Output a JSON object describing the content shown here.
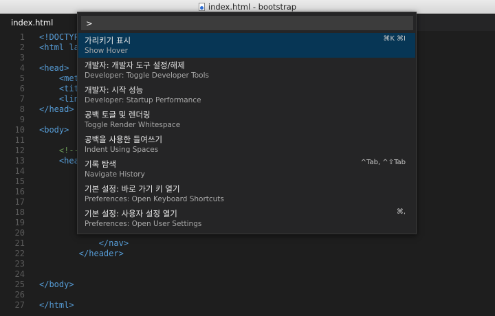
{
  "window": {
    "title": "index.html - bootstrap"
  },
  "tabs": [
    {
      "label": "index.html"
    }
  ],
  "editor": {
    "lines": [
      {
        "n": "1",
        "text": "<!DOCTYP"
      },
      {
        "n": "2",
        "text": "<html la"
      },
      {
        "n": "3",
        "text": ""
      },
      {
        "n": "4",
        "text": "<head>"
      },
      {
        "n": "5",
        "text": "    <met"
      },
      {
        "n": "6",
        "text": "    <tit"
      },
      {
        "n": "7",
        "text": "    <lin"
      },
      {
        "n": "8",
        "text": "</head>"
      },
      {
        "n": "9",
        "text": ""
      },
      {
        "n": "10",
        "text": "<body>"
      },
      {
        "n": "11",
        "text": ""
      },
      {
        "n": "12",
        "text": "    <!--"
      },
      {
        "n": "13",
        "text": "    <hea"
      },
      {
        "n": "14",
        "text": ""
      },
      {
        "n": "15",
        "text": ""
      },
      {
        "n": "16",
        "text": ""
      },
      {
        "n": "17",
        "text": ""
      },
      {
        "n": "18",
        "text": ""
      },
      {
        "n": "19",
        "text": ""
      },
      {
        "n": "20",
        "text": ""
      },
      {
        "n": "21",
        "text": "            </nav>"
      },
      {
        "n": "22",
        "text": "        </header>"
      },
      {
        "n": "23",
        "text": ""
      },
      {
        "n": "24",
        "text": ""
      },
      {
        "n": "25",
        "text": "</body>"
      },
      {
        "n": "26",
        "text": ""
      },
      {
        "n": "27",
        "text": "</html>"
      }
    ]
  },
  "palette": {
    "input_value": ">",
    "items": [
      {
        "title": "가리키기 표시",
        "subtitle": "Show Hover",
        "keybinding": "⌘K ⌘I",
        "selected": true
      },
      {
        "title": "개발자: 개발자 도구 설정/해제",
        "subtitle": "Developer: Toggle Developer Tools",
        "keybinding": ""
      },
      {
        "title": "개발자: 시작 성능",
        "subtitle": "Developer: Startup Performance",
        "keybinding": ""
      },
      {
        "title": "공백 토글 및 렌더링",
        "subtitle": "Toggle Render Whitespace",
        "keybinding": ""
      },
      {
        "title": "공백을 사용한 들여쓰기",
        "subtitle": "Indent Using Spaces",
        "keybinding": ""
      },
      {
        "title": "기록 탐색",
        "subtitle": "Navigate History",
        "keybinding": "^Tab, ^⇧Tab"
      },
      {
        "title": "기본 설정: 바로 가기 키 열기",
        "subtitle": "Preferences: Open Keyboard Shortcuts",
        "keybinding": ""
      },
      {
        "title": "기본 설정: 사용자 설정 열기",
        "subtitle": "Preferences: Open User Settings",
        "keybinding": "⌘,"
      }
    ]
  },
  "colors": {
    "editor_bg": "#1e1e1e",
    "palette_bg": "#252526",
    "selection_bg": "#073655",
    "tag": "#569cd6",
    "comment": "#6a9955",
    "line_number": "#5a5a5a"
  }
}
